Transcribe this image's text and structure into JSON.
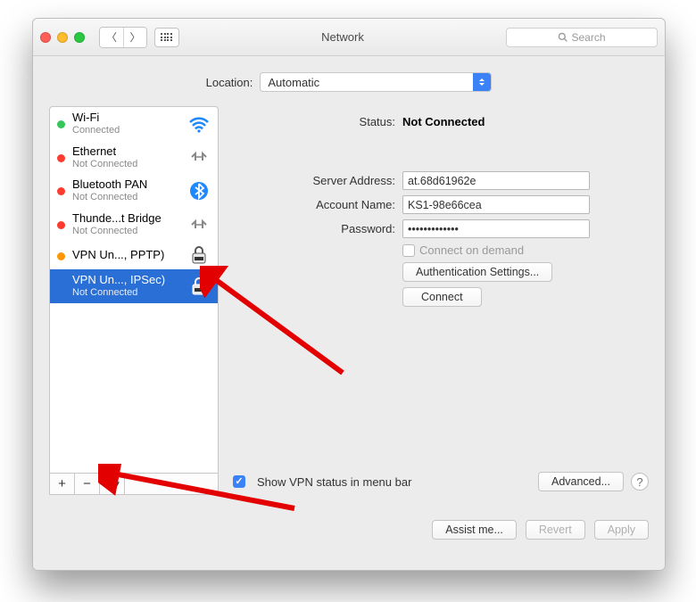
{
  "titlebar": {
    "title": "Network",
    "search_placeholder": "Search"
  },
  "location": {
    "label": "Location:",
    "value": "Automatic"
  },
  "services": [
    {
      "name": "Wi-Fi",
      "status": "Connected",
      "dot": "green",
      "icon": "wifi"
    },
    {
      "name": "Ethernet",
      "status": "Not Connected",
      "dot": "red",
      "icon": "ethernet"
    },
    {
      "name": "Bluetooth PAN",
      "status": "Not Connected",
      "dot": "red",
      "icon": "bluetooth"
    },
    {
      "name": "Thunde...t Bridge",
      "status": "Not Connected",
      "dot": "red",
      "icon": "ethernet"
    },
    {
      "name": "VPN Un..., PPTP)",
      "status": "",
      "dot": "orange",
      "icon": "vpn"
    },
    {
      "name": "VPN Un..., IPSec)",
      "status": "Not Connected",
      "dot": "none",
      "icon": "vpn",
      "selected": true
    }
  ],
  "sidebar_buttons": {
    "add": "+",
    "remove": "−",
    "gear": "⚙︎▾"
  },
  "details": {
    "status_label": "Status:",
    "status_value": "Not Connected",
    "server_label": "Server Address:",
    "server_value": "at.68d61962e",
    "account_label": "Account Name:",
    "account_value": "KS1-98e66cea",
    "password_label": "Password:",
    "password_value": "•••••••••••••",
    "connect_on_demand": "Connect on demand",
    "auth_settings": "Authentication Settings...",
    "connect": "Connect",
    "show_vpn_status": "Show VPN status in menu bar",
    "advanced": "Advanced...",
    "help": "?"
  },
  "footer": {
    "assist": "Assist me...",
    "revert": "Revert",
    "apply": "Apply"
  },
  "colors": {
    "selection": "#2a6fd6",
    "accent": "#3b82f6"
  }
}
